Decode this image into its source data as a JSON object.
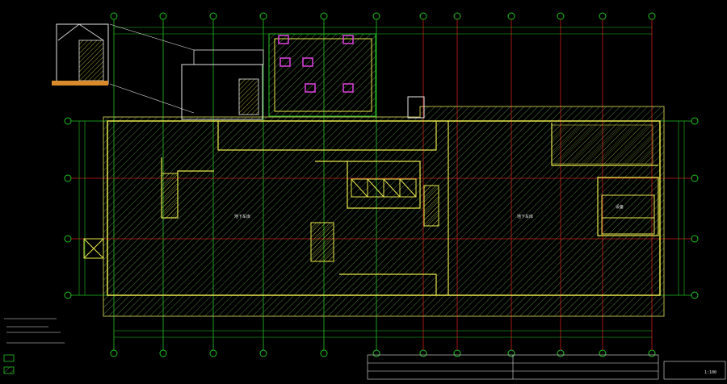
{
  "drawing": {
    "background": "#000000",
    "colors": {
      "grid_green": "#22c322",
      "grid_red": "#d01818",
      "wall_yellow": "#e8e84a",
      "hatch": "#3f6f3f",
      "label_white": "#e6e6e6",
      "magenta": "#e040e0",
      "cyan": "#40d0e0"
    },
    "title_block_label": "1:100",
    "room_labels": [
      "地下车库",
      "地下车库",
      "设备"
    ]
  }
}
